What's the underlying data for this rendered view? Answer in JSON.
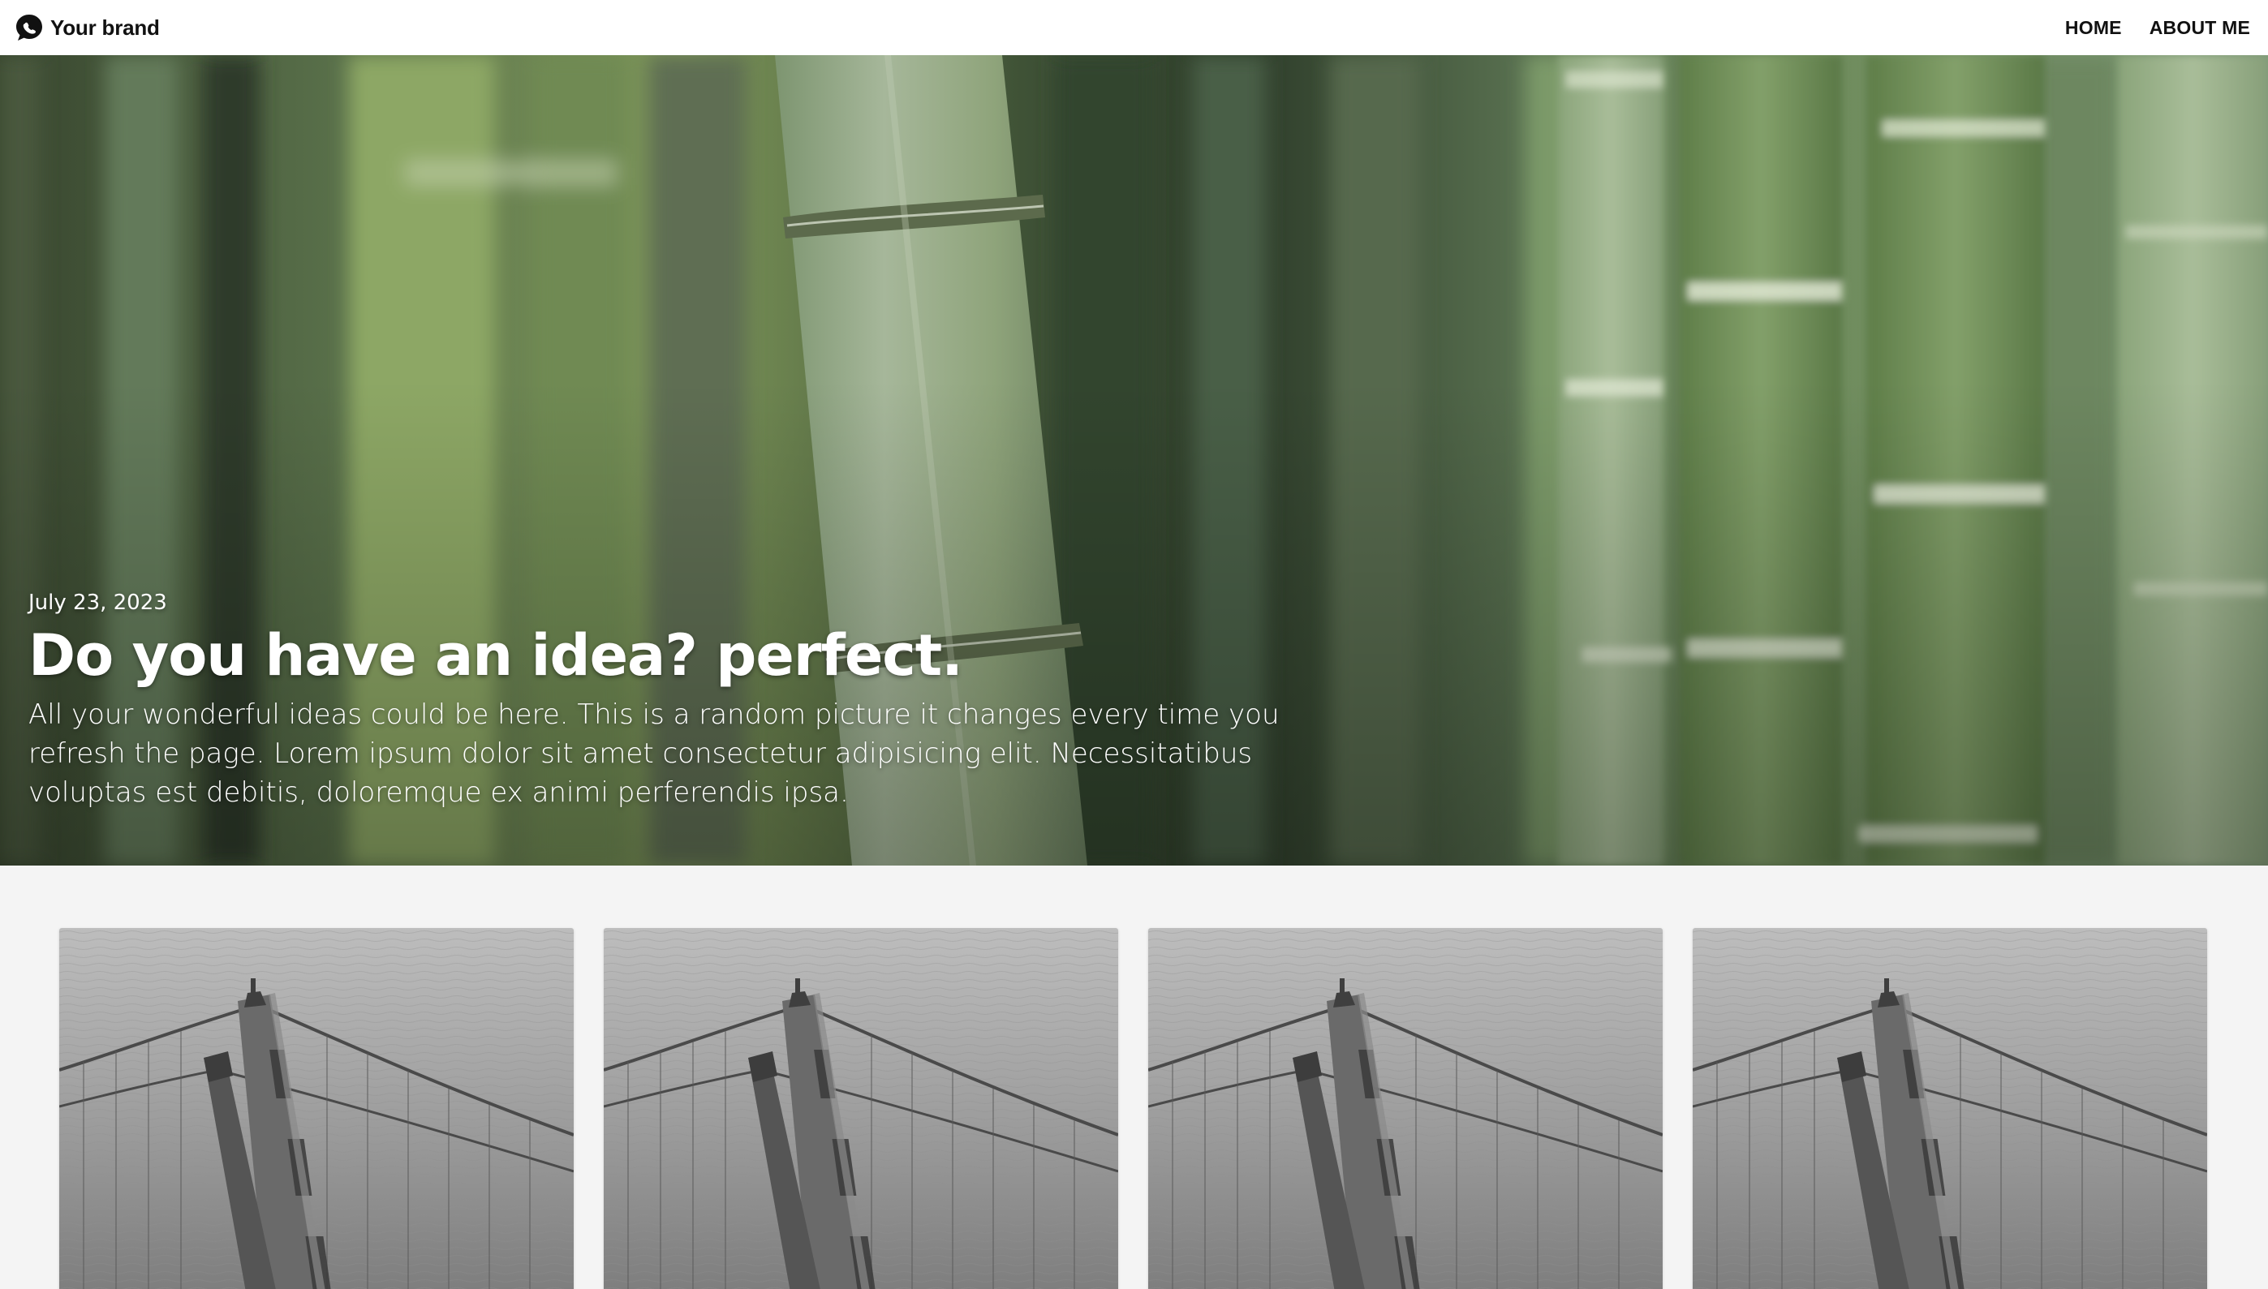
{
  "navbar": {
    "brand_icon": "chat-bubble-icon",
    "brand": "Your brand",
    "links": [
      {
        "label": "HOME"
      },
      {
        "label": "ABOUT ME"
      }
    ]
  },
  "hero": {
    "image": "bamboo-forest-photo",
    "date": "July 23, 2023",
    "title": "Do you have an idea? perfect.",
    "text": "All your wonderful ideas could be here. This is a random picture it changes every time you refresh the page. Lorem ipsum dolor sit amet consectetur adipisicing elit. Necessitatibus voluptas est debitis, doloremque ex animi perferendis ipsa."
  },
  "cards": [
    {
      "image": "bridge-tower-photo"
    },
    {
      "image": "bridge-tower-photo"
    },
    {
      "image": "bridge-tower-photo"
    },
    {
      "image": "bridge-tower-photo"
    }
  ],
  "colors": {
    "navbar_bg": "#ffffff",
    "page_bg": "#f4f4f4",
    "text_dark": "#111111",
    "hero_text": "#ffffff"
  }
}
